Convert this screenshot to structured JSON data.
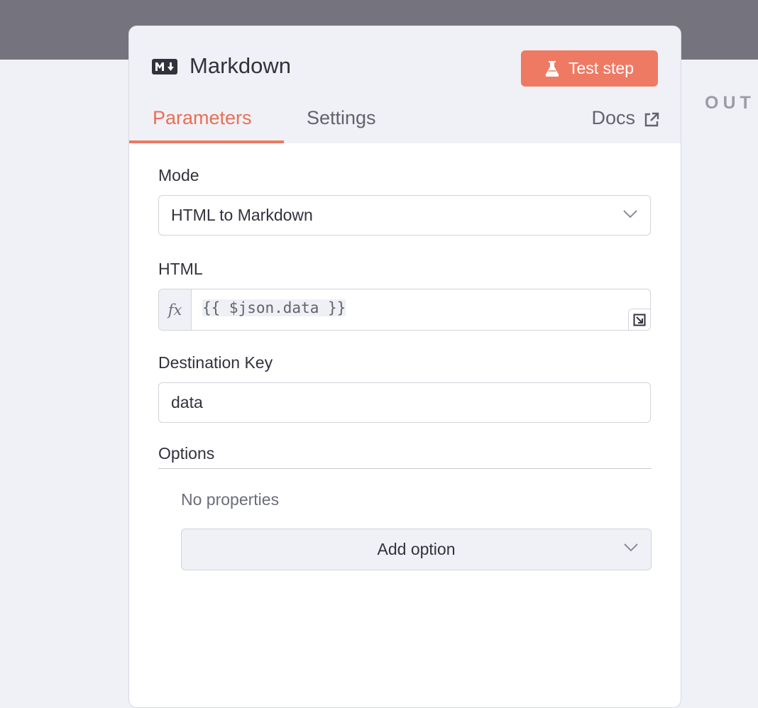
{
  "background": {
    "output_label": "OUT"
  },
  "node": {
    "icon": "markdown-icon",
    "title": "Markdown",
    "test_button_label": "Test step",
    "test_button_icon": "flask-icon",
    "accent_color": "#ef7a64"
  },
  "tabs": [
    {
      "label": "Parameters",
      "active": true
    },
    {
      "label": "Settings",
      "active": false
    }
  ],
  "docs": {
    "label": "Docs",
    "icon": "external-link-icon"
  },
  "parameters": {
    "mode": {
      "label": "Mode",
      "value": "HTML to Markdown"
    },
    "html": {
      "label": "HTML",
      "fx_label": "fx",
      "value": "{{ $json.data }}"
    },
    "destination_key": {
      "label": "Destination Key",
      "value": "data"
    },
    "options": {
      "label": "Options",
      "empty_text": "No properties",
      "add_label": "Add option"
    }
  }
}
